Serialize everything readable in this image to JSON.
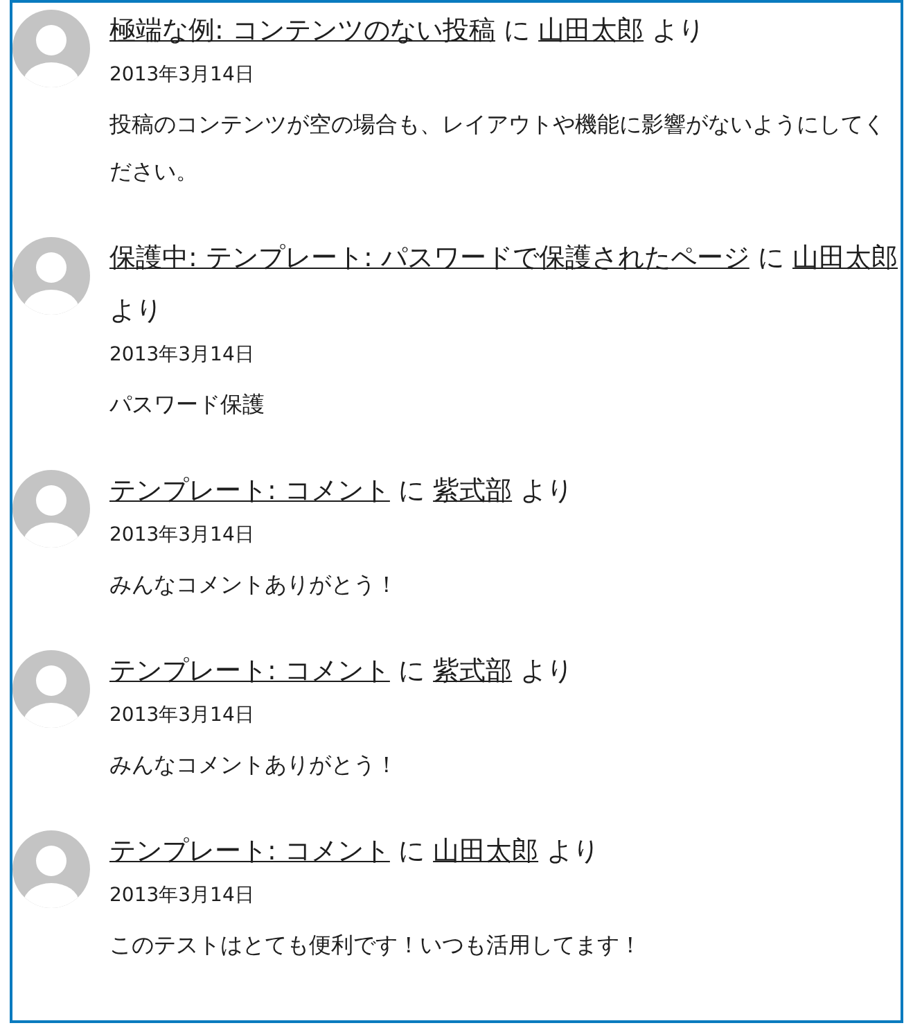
{
  "comments": [
    {
      "post": "極端な例: コンテンツのない投稿",
      "connector": "に",
      "author": "山田太郎",
      "suffix": "より",
      "date": "2013年3月14日",
      "excerpt": "投稿のコンテンツが空の場合も、レイアウトや機能に影響がないようにしてください。"
    },
    {
      "post": "保護中: テンプレート: パスワードで保護されたページ",
      "connector": "に",
      "author": "山田太郎",
      "suffix": "より",
      "date": "2013年3月14日",
      "excerpt": "パスワード保護"
    },
    {
      "post": "テンプレート: コメント",
      "connector": "に",
      "author": "紫式部",
      "suffix": "より",
      "date": "2013年3月14日",
      "excerpt": "みんなコメントありがとう！"
    },
    {
      "post": "テンプレート: コメント",
      "connector": "に",
      "author": "紫式部",
      "suffix": "より",
      "date": "2013年3月14日",
      "excerpt": "みんなコメントありがとう！"
    },
    {
      "post": "テンプレート: コメント",
      "connector": "に",
      "author": "山田太郎",
      "suffix": "より",
      "date": "2013年3月14日",
      "excerpt": "このテストはとても便利です！いつも活用してます！"
    }
  ]
}
